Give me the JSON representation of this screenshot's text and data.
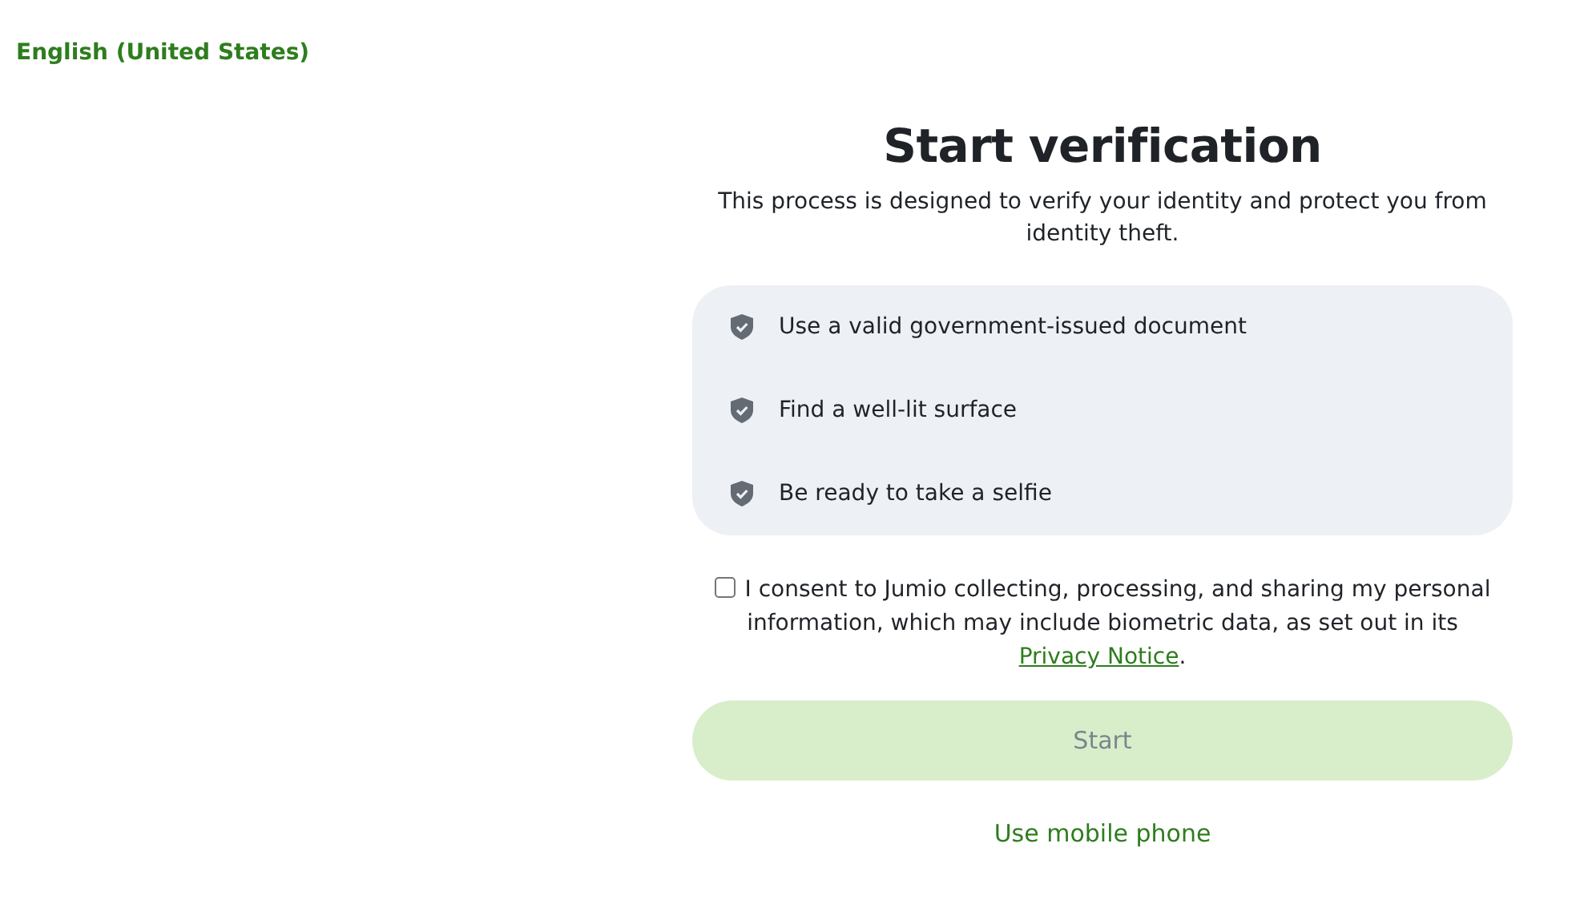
{
  "language_link": "English (United States)",
  "title": "Start verification",
  "subtitle": "This process is designed to verify your identity and protect you from identity theft.",
  "checklist": [
    {
      "text": "Use a valid government-issued document"
    },
    {
      "text": "Find a well-lit surface"
    },
    {
      "text": "Be ready to take a selfie"
    }
  ],
  "consent": {
    "checked": false,
    "text": "I consent to Jumio collecting, processing, and sharing my personal information, which may include biometric data, as set out in its ",
    "link": "Privacy Notice",
    "after": "."
  },
  "start_button": {
    "label": "Start",
    "disabled": true
  },
  "mobile_link": "Use mobile phone"
}
